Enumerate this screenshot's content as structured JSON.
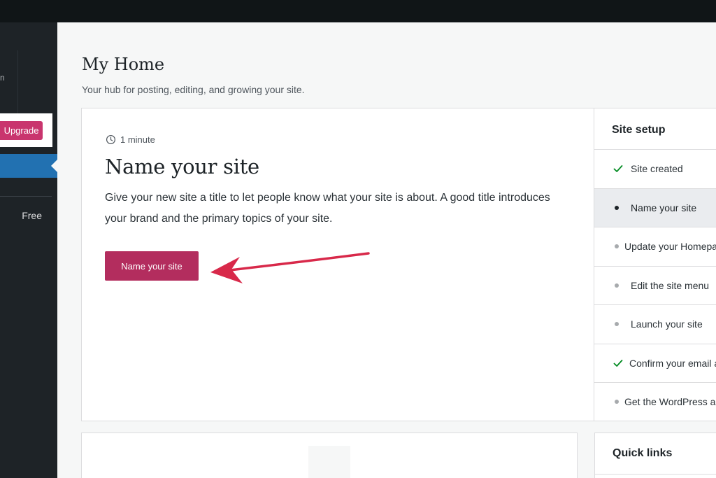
{
  "sidebar": {
    "site_card_glyph": "n",
    "upgrade_label": "Upgrade",
    "plan_label": "Free"
  },
  "page": {
    "title": "My Home",
    "subtitle": "Your hub for posting, editing, and growing your site."
  },
  "task": {
    "time_estimate": "1 minute",
    "title": "Name your site",
    "description": "Give your new site a title to let people know what your site is about. A good title introduces your brand and the primary topics of your site.",
    "button_label": "Name your site"
  },
  "site_setup": {
    "heading": "Site setup",
    "items": [
      {
        "label": "Site created",
        "state": "done"
      },
      {
        "label": "Name your site",
        "state": "current"
      },
      {
        "label": "Update your Homepage",
        "state": "todo"
      },
      {
        "label": "Edit the site menu",
        "state": "todo"
      },
      {
        "label": "Launch your site",
        "state": "todo"
      },
      {
        "label": "Confirm your email address",
        "state": "done"
      },
      {
        "label": "Get the WordPress app",
        "state": "todo"
      }
    ]
  },
  "quick_links": {
    "heading": "Quick links"
  },
  "colors": {
    "accent_pink": "#c9356e",
    "cta": "#b32d5e",
    "nav_active": "#2271b1",
    "arrow": "#d8294a",
    "sidebar_bg": "#1e2327"
  }
}
